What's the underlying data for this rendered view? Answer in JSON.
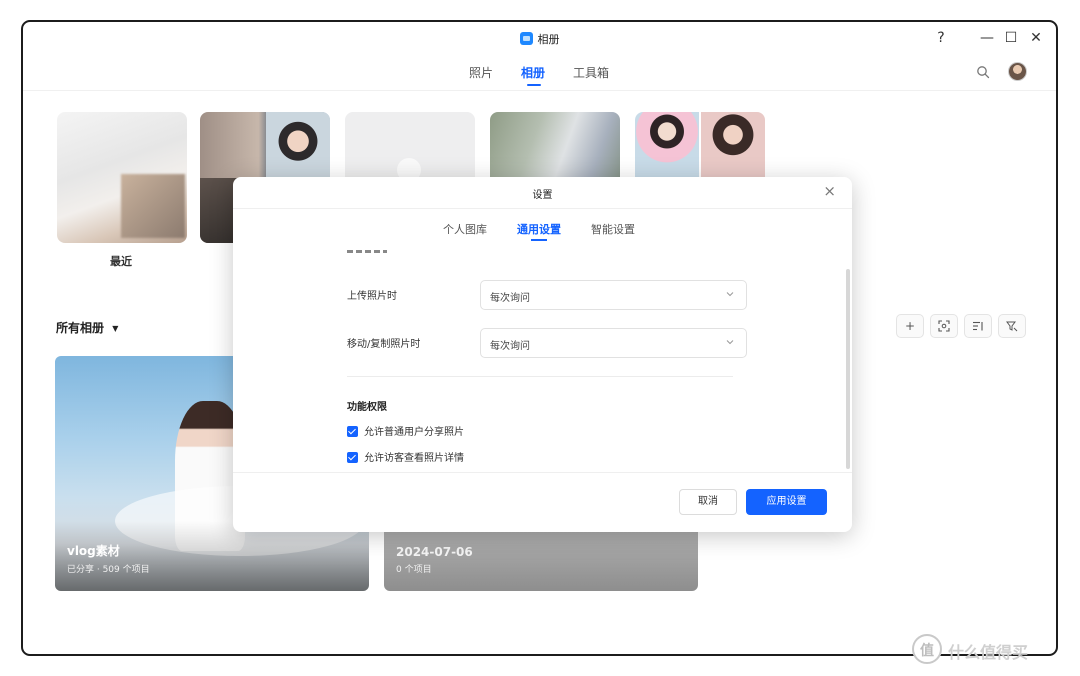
{
  "window": {
    "app_title": "相册",
    "help_label": "?",
    "minimize_label": "—",
    "maximize_label": "☐",
    "close_label": "✕"
  },
  "nav": {
    "tabs": [
      {
        "label": "照片",
        "active": false
      },
      {
        "label": "相册",
        "active": true
      },
      {
        "label": "工具箱",
        "active": false
      }
    ]
  },
  "recent": {
    "label": "最近"
  },
  "albums_section": {
    "title": "所有相册",
    "dropdown_icon": "caret-down-icon",
    "tools": [
      "add-icon",
      "face-scan-icon",
      "sort-icon",
      "filter-icon"
    ],
    "add_label": "+"
  },
  "album_cards": [
    {
      "name": "vlog素材",
      "meta": "已分享 · 509 个项目"
    },
    {
      "name": "2024-07-06",
      "meta": "0 个项目"
    }
  ],
  "dialog": {
    "title": "设置",
    "close_label": "×",
    "tabs": [
      {
        "label": "个人图库",
        "active": false
      },
      {
        "label": "通用设置",
        "active": true
      },
      {
        "label": "智能设置",
        "active": false
      }
    ],
    "upload": {
      "label": "上传照片时",
      "value": "每次询问"
    },
    "move_copy": {
      "label": "移动/复制照片时",
      "value": "每次询问"
    },
    "permissions": {
      "title": "功能权限",
      "items": [
        {
          "label": "允许普通用户分享照片",
          "checked": true
        },
        {
          "label": "允许访客查看照片详情",
          "checked": true
        }
      ]
    },
    "cancel_label": "取消",
    "apply_label": "应用设置"
  },
  "watermark": {
    "logo_text": "值",
    "text": "什么值得买"
  },
  "colors": {
    "accent": "#1463ff",
    "window_border": "#1c1c1c"
  }
}
